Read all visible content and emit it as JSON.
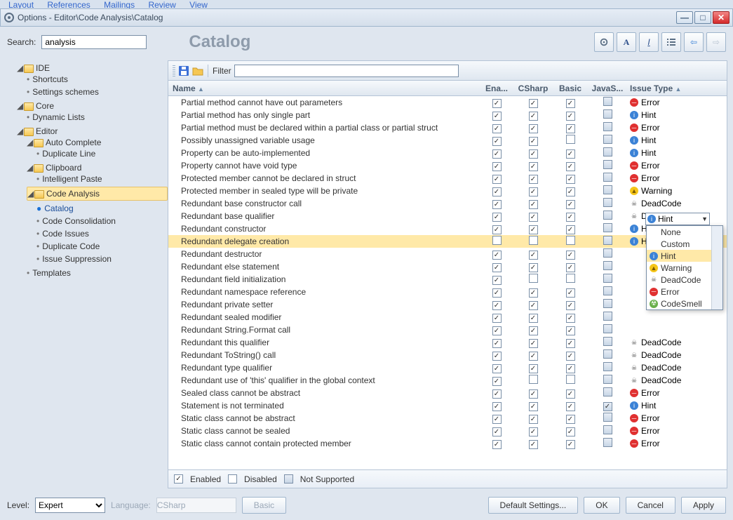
{
  "menubar": [
    "Layout",
    "References",
    "Mailings",
    "Review",
    "View"
  ],
  "window": {
    "title": "Options - Editor\\Code Analysis\\Catalog"
  },
  "search": {
    "label": "Search:",
    "value": "analysis"
  },
  "page_title": "Catalog",
  "toolbar_icons": [
    "gear-icon",
    "font-icon",
    "italic-icon",
    "list-icon",
    "arrow-left-icon",
    "arrow-right-icon"
  ],
  "tree": {
    "ide": {
      "label": "IDE",
      "children": [
        "Shortcuts",
        "Settings schemes"
      ]
    },
    "core": {
      "label": "Core",
      "children": [
        "Dynamic Lists"
      ]
    },
    "editor": {
      "label": "Editor",
      "auto": {
        "label": "Auto Complete",
        "children": [
          "Duplicate Line"
        ]
      },
      "clip": {
        "label": "Clipboard",
        "children": [
          "Intelligent Paste"
        ]
      },
      "code": {
        "label": "Code Analysis",
        "children": [
          "Catalog",
          "Code Consolidation",
          "Code Issues",
          "Duplicate Code",
          "Issue Suppression"
        ]
      },
      "templates": "Templates"
    }
  },
  "filter": {
    "label": "Filter",
    "value": ""
  },
  "columns": {
    "name": "Name",
    "ena": "Ena...",
    "csharp": "CSharp",
    "basic": "Basic",
    "javas": "JavaS...",
    "issue": "Issue Type"
  },
  "rows": [
    {
      "n": "Partial method cannot have out parameters",
      "e": 1,
      "c": 1,
      "b": 1,
      "j": 0,
      "t": "Error"
    },
    {
      "n": "Partial method has only single part",
      "e": 1,
      "c": 1,
      "b": 1,
      "j": 0,
      "t": "Hint"
    },
    {
      "n": "Partial method must be declared within a partial class or partial struct",
      "e": 1,
      "c": 1,
      "b": 1,
      "j": 0,
      "t": "Error"
    },
    {
      "n": "Possibly unassigned variable usage",
      "e": 1,
      "c": 1,
      "b": 0,
      "j": 0,
      "t": "Hint"
    },
    {
      "n": "Property can be auto-implemented",
      "e": 1,
      "c": 1,
      "b": 1,
      "j": 0,
      "t": "Hint"
    },
    {
      "n": "Property cannot have void type",
      "e": 1,
      "c": 1,
      "b": 1,
      "j": 0,
      "t": "Error"
    },
    {
      "n": "Protected member cannot be declared in struct",
      "e": 1,
      "c": 1,
      "b": 1,
      "j": 0,
      "t": "Error"
    },
    {
      "n": "Protected member in sealed type will be private",
      "e": 1,
      "c": 1,
      "b": 1,
      "j": 0,
      "t": "Warning"
    },
    {
      "n": "Redundant base constructor call",
      "e": 1,
      "c": 1,
      "b": 1,
      "j": 0,
      "t": "DeadCode"
    },
    {
      "n": "Redundant base qualifier",
      "e": 1,
      "c": 1,
      "b": 1,
      "j": 0,
      "t": "DeadCode"
    },
    {
      "n": "Redundant constructor",
      "e": 1,
      "c": 1,
      "b": 1,
      "j": 0,
      "t": "Hint"
    },
    {
      "n": "Redundant delegate creation",
      "e": 0,
      "c": 0,
      "b": 0,
      "j": 0,
      "t": "Hint",
      "sel": true
    },
    {
      "n": "Redundant destructor",
      "e": 1,
      "c": 1,
      "b": 1,
      "j": 0,
      "t": ""
    },
    {
      "n": "Redundant else statement",
      "e": 1,
      "c": 1,
      "b": 1,
      "j": 0,
      "t": ""
    },
    {
      "n": "Redundant field initialization",
      "e": 1,
      "c": 0,
      "b": 0,
      "j": 0,
      "t": ""
    },
    {
      "n": "Redundant namespace reference",
      "e": 1,
      "c": 1,
      "b": 1,
      "j": 0,
      "t": ""
    },
    {
      "n": "Redundant private setter",
      "e": 1,
      "c": 1,
      "b": 1,
      "j": 0,
      "t": ""
    },
    {
      "n": "Redundant sealed modifier",
      "e": 1,
      "c": 1,
      "b": 1,
      "j": 0,
      "t": ""
    },
    {
      "n": "Redundant String.Format call",
      "e": 1,
      "c": 1,
      "b": 1,
      "j": 0,
      "t": ""
    },
    {
      "n": "Redundant this qualifier",
      "e": 1,
      "c": 1,
      "b": 1,
      "j": 0,
      "t": "DeadCode"
    },
    {
      "n": "Redundant ToString() call",
      "e": 1,
      "c": 1,
      "b": 1,
      "j": 0,
      "t": "DeadCode"
    },
    {
      "n": "Redundant type qualifier",
      "e": 1,
      "c": 1,
      "b": 1,
      "j": 0,
      "t": "DeadCode"
    },
    {
      "n": "Redundant use of 'this' qualifier in the global context",
      "e": 1,
      "c": 0,
      "b": 0,
      "j": 0,
      "t": "DeadCode"
    },
    {
      "n": "Sealed class cannot be abstract",
      "e": 1,
      "c": 1,
      "b": 1,
      "j": 0,
      "t": "Error"
    },
    {
      "n": "Statement is not terminated",
      "e": 1,
      "c": 1,
      "b": 1,
      "j": 1,
      "t": "Hint"
    },
    {
      "n": "Static class cannot be abstract",
      "e": 1,
      "c": 1,
      "b": 1,
      "j": 0,
      "t": "Error"
    },
    {
      "n": "Static class cannot be sealed",
      "e": 1,
      "c": 1,
      "b": 1,
      "j": 0,
      "t": "Error"
    },
    {
      "n": "Static class cannot contain protected member",
      "e": 1,
      "c": 1,
      "b": 1,
      "j": 0,
      "t": "Error"
    }
  ],
  "legend": {
    "enabled": "Enabled",
    "disabled": "Disabled",
    "notsup": "Not Supported"
  },
  "level": {
    "label": "Level:",
    "value": "Expert"
  },
  "language": {
    "label": "Language:",
    "value": "CSharp"
  },
  "buttons": {
    "basic": "Basic",
    "defaults": "Default Settings...",
    "ok": "OK",
    "cancel": "Cancel",
    "apply": "Apply"
  },
  "editor": {
    "value": "Hint"
  },
  "dropdown": [
    "None",
    "Custom",
    "Hint",
    "Warning",
    "DeadCode",
    "Error",
    "CodeSmell"
  ]
}
